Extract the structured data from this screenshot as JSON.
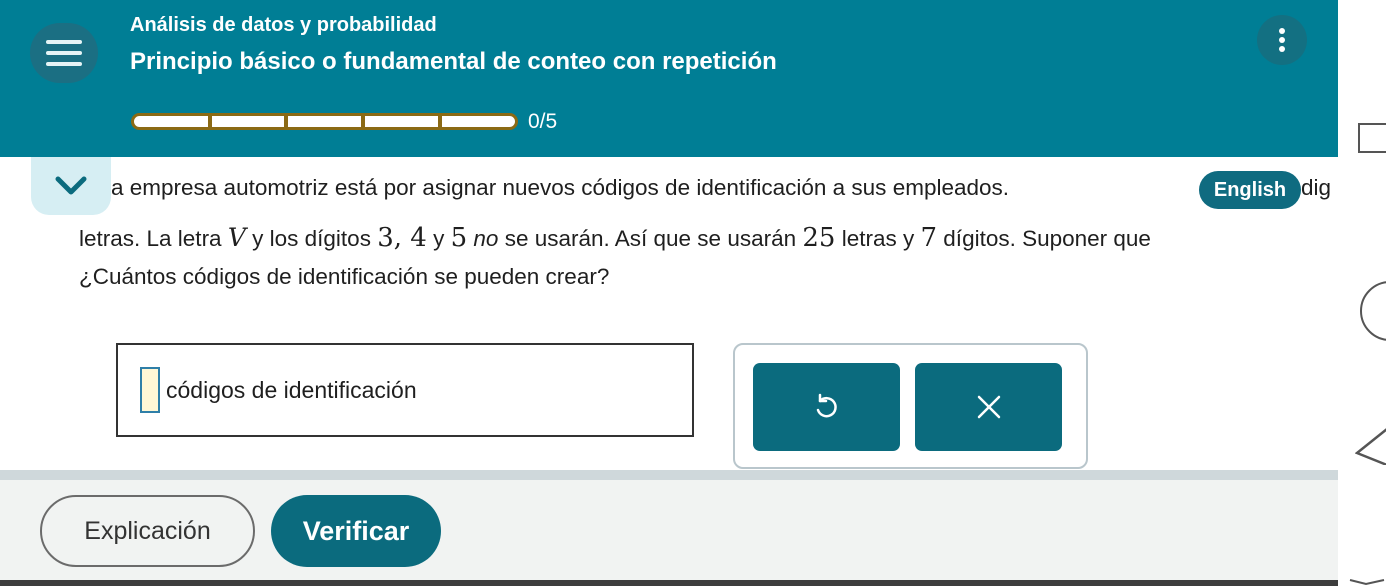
{
  "header": {
    "subject": "Análisis de datos y probabilidad",
    "topic": "Principio básico o fundamental de conteo con repetición",
    "progress_text": "0/5",
    "progress": {
      "completed": 0,
      "total": 5
    },
    "background_color": "#007e95"
  },
  "icons": {
    "menu": "hamburger-menu-icon",
    "more": "vertical-dots-icon",
    "collapse": "chevron-down-icon",
    "undo": "undo-icon",
    "clear": "close-icon"
  },
  "problem": {
    "line1_start": "a empresa automotriz está por asignar nuevos códigos de identificación a sus empleados.",
    "translate_label": "English",
    "line1_end": "dig",
    "line2": {
      "t1": "letras. La letra ",
      "v": "V",
      "t2": " y los dígitos ",
      "d1": "3, 4",
      "t3": " y ",
      "d2": "5",
      "t4": " ",
      "no": "no",
      "t5": " se usarán. Así que se usarán ",
      "n1": "25",
      "t6": " letras y ",
      "n2": "7",
      "t7": " dígitos. Suponer que"
    },
    "line3": "¿Cuántos códigos de identificación se pueden crear?"
  },
  "answer": {
    "value": "",
    "unit": "códigos de identificación"
  },
  "tools": {
    "clear_label": "×"
  },
  "footer": {
    "explain_label": "Explicación",
    "verify_label": "Verificar"
  }
}
